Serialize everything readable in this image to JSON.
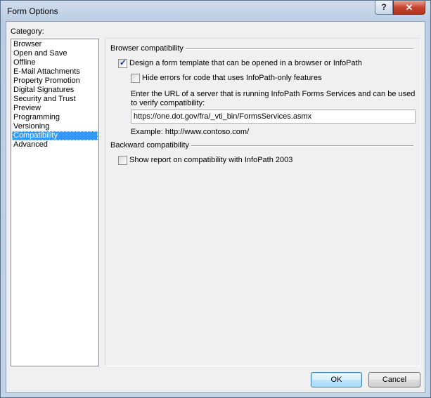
{
  "window": {
    "title": "Form Options",
    "help_label": "?",
    "close_label": "✕"
  },
  "category": {
    "label": "Category:",
    "items": [
      "Browser",
      "Open and Save",
      "Offline",
      "E-Mail Attachments",
      "Property Promotion",
      "Digital Signatures",
      "Security and Trust",
      "Preview",
      "Programming",
      "Versioning",
      "Compatibility",
      "Advanced"
    ],
    "selected": "Compatibility"
  },
  "browser_compat": {
    "group_title": "Browser compatibility",
    "design_checkbox_label": "Design a form template that can be opened in a browser or InfoPath",
    "design_checked": true,
    "hide_errors_label": "Hide errors for code that uses InfoPath-only features",
    "hide_errors_checked": false,
    "url_prompt_line1": "Enter the URL of a server that is running InfoPath Forms Services and can be used",
    "url_prompt_line2": "to verify compatibility:",
    "url_value": "https://one.dot.gov/fra/_vti_bin/FormsServices.asmx",
    "example_text": "Example: http://www.contoso.com/"
  },
  "backward_compat": {
    "group_title": "Backward compatibility",
    "report_label": "Show report on compatibility with InfoPath 2003",
    "report_checked": false
  },
  "buttons": {
    "ok": "OK",
    "cancel": "Cancel"
  },
  "icons": {
    "checkmark": "checkmark-icon"
  }
}
